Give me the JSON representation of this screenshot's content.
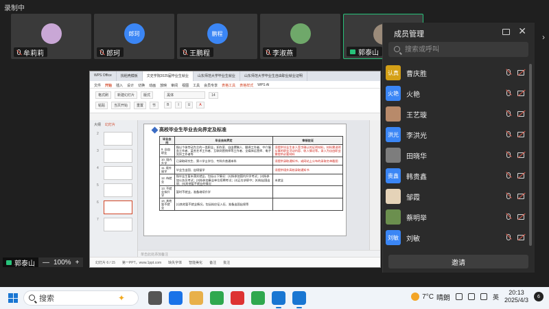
{
  "recording_label": "录制中",
  "video_tiles": [
    {
      "name": "牟莉莉",
      "avatar_text": "",
      "avatar_color": "#c9a7d6",
      "active": false
    },
    {
      "name": "郎珂",
      "avatar_text": "郎珂",
      "avatar_color": "#3b86f5",
      "active": false
    },
    {
      "name": "王鹏程",
      "avatar_text": "鹏程",
      "avatar_color": "#3b86f5",
      "active": false
    },
    {
      "name": "李淑燕",
      "avatar_text": "",
      "avatar_color": "#6fa86a",
      "active": false
    },
    {
      "name": "郭泰山",
      "avatar_text": "",
      "avatar_color": "#9b8b7a",
      "active": true
    }
  ],
  "doc_window": {
    "tabs": [
      "WPS Office",
      "找稻壳模板",
      "文史学院2025届毕业生就业",
      "山东师范大学毕业生就业",
      "山东师范大学毕业生自由职业就业证明"
    ],
    "menus": [
      "文件",
      "开始",
      "插入",
      "设计",
      "切换",
      "动画",
      "放映",
      "审阅",
      "视图",
      "工具",
      "会员专享",
      "表格工具",
      "表格样式",
      "WPS AI"
    ],
    "ribbon": {
      "new_slide": "新建幻灯片",
      "layout": "版式",
      "section": "节",
      "format_painter": "格式刷",
      "reset": "重置",
      "paste": "粘贴",
      "font": "黑体",
      "font_size": "14",
      "current_start": "当页开始"
    },
    "thumb_header": [
      "大纲",
      "幻灯片"
    ],
    "thumbnails": [
      "2",
      "3",
      "4",
      "5",
      "6",
      "7"
    ],
    "selected_thumb": "6",
    "slide_title": "高校毕业生毕业去向界定及标准",
    "table_headers": [
      "毕业去向",
      "毕业去向界定",
      "审核佐证"
    ],
    "table_rows": [
      {
        "cat": "9. 自由职业",
        "def": "指以个体劳动为主的一类职业，如作家、自由撰稿人、翻译工作者、中介服务工作者、某些艺术工作者、互联网营销师等工作者、全媒体运营师、电子竞技工作者等",
        "proof": "须提供毕业生本人签字确认的证明材料，材料需说明从事的职业活动内容、收入情况等。录入为自由职业需提供必要材料",
        "proof_red": true
      },
      {
        "cat": "10. 境内升学",
        "def": "已录取研究生、第二学士学位、专科升普通本科",
        "proof": "须提供录取通知书，或网站上公布的录取名单截图",
        "proof_red": true
      },
      {
        "cat": "11. 境外留学",
        "def": "毕业生出国、出境留学",
        "proof": "须提供境外高校录取通知书",
        "proof_red": true
      },
      {
        "cat": "12. 待就业",
        "def": "指毕业生暂未落实就业，包括以下情况：(1)拟参加国内升学考试；(2)拟参加公务员考试；(3)拟参加事业单位招聘考试；(4)正在求职中；(5)拟出国出境；(6)其他暂不就业的情况",
        "proof": "未就业",
        "proof_red": false
      },
      {
        "cat": "13. 不就业拟升学",
        "def": "暂时不就业，准备继续升学",
        "proof": "",
        "proof_red": false
      },
      {
        "cat": "14. 其他暂不就业",
        "def": "(1)其他暂不就业情况，包括拟应征入伍、准备出国出境等",
        "proof": "",
        "proof_red": false
      }
    ],
    "note_placeholder": "单击此处添加备注",
    "status": [
      "幻灯片 6 / 15",
      "第一PPT，www.1ppt.com",
      "缺失字体",
      "智能美化",
      "备注",
      "批注"
    ]
  },
  "member_panel": {
    "title": "成员管理",
    "search_placeholder": "搜索或呼叫",
    "members": [
      {
        "name": "曹庆胜",
        "avatar_text": "认真",
        "avatar_color": "#d4a017"
      },
      {
        "name": "火艳",
        "avatar_text": "火艳",
        "avatar_color": "#3b86f5"
      },
      {
        "name": "王艺璇",
        "avatar_text": "",
        "avatar_color": "#b88a6a"
      },
      {
        "name": "李洪光",
        "avatar_text": "洪光",
        "avatar_color": "#3b86f5"
      },
      {
        "name": "田晓华",
        "avatar_text": "",
        "avatar_color": "#7d7d7d"
      },
      {
        "name": "韩贵鑫",
        "avatar_text": "贵鑫",
        "avatar_color": "#3b86f5"
      },
      {
        "name": "邹霞",
        "avatar_text": "",
        "avatar_color": "#e5d3b8"
      },
      {
        "name": "蔡明举",
        "avatar_text": "",
        "avatar_color": "#6b8f4e"
      },
      {
        "name": "刘敏",
        "avatar_text": "刘敏",
        "avatar_color": "#3b86f5"
      }
    ],
    "invite_label": "邀请"
  },
  "presenter_name": "郭泰山",
  "zoom": {
    "minus": "—",
    "value": "100%",
    "plus": "+"
  },
  "taskbar": {
    "search_placeholder": "搜索",
    "apps": [
      "#555",
      "#1a73e8",
      "#e8b04a",
      "#2fa84f",
      "#d33",
      "#2fa84f",
      "#1976d2",
      "#1976d2"
    ],
    "weather_temp": "7°C",
    "weather_text": "晴朗",
    "ime": "英",
    "time": "20:13",
    "date": "2025/4/3",
    "notif_count": "6"
  }
}
